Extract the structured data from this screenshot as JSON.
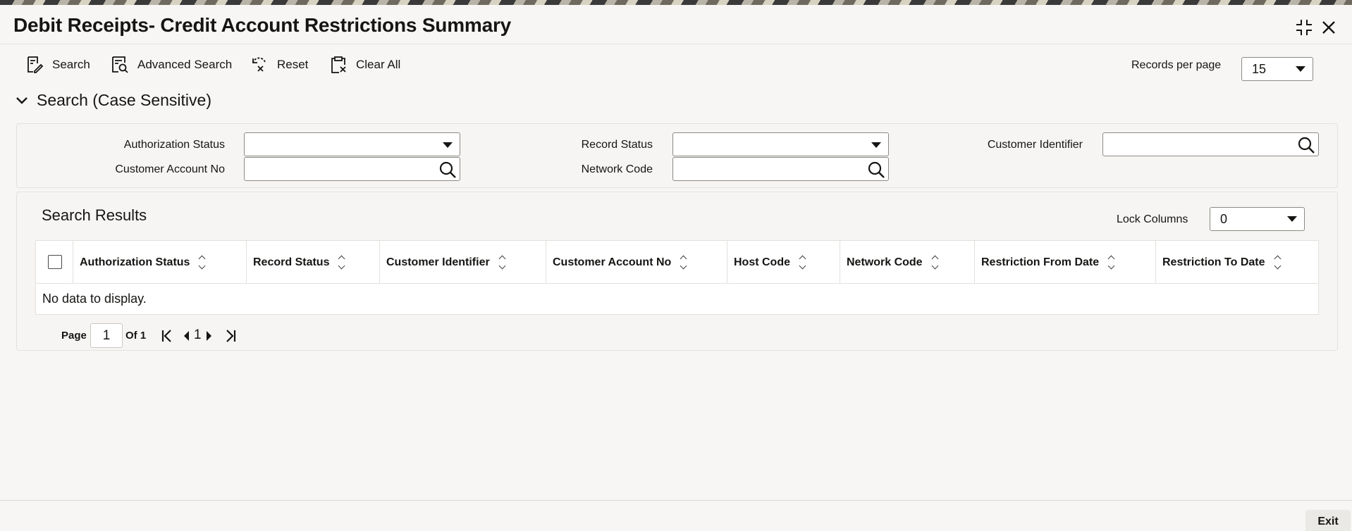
{
  "window": {
    "title": "Debit Receipts- Credit Account Restrictions Summary"
  },
  "toolbar": {
    "search_label": "Search",
    "advanced_search_label": "Advanced Search",
    "reset_label": "Reset",
    "clear_all_label": "Clear All",
    "records_per_page_label": "Records per page",
    "records_per_page_value": "15"
  },
  "search_section": {
    "title": "Search (Case Sensitive)",
    "fields": {
      "authorization_status": {
        "label": "Authorization Status",
        "value": ""
      },
      "record_status": {
        "label": "Record Status",
        "value": ""
      },
      "customer_identifier": {
        "label": "Customer Identifier",
        "value": ""
      },
      "customer_account_no": {
        "label": "Customer Account No",
        "value": ""
      },
      "network_code": {
        "label": "Network Code",
        "value": ""
      }
    }
  },
  "results": {
    "title": "Search Results",
    "lock_columns_label": "Lock Columns",
    "lock_columns_value": "0",
    "columns": [
      "Authorization Status",
      "Record Status",
      "Customer Identifier",
      "Customer Account No",
      "Host Code",
      "Network Code",
      "Restriction From Date",
      "Restriction To Date"
    ],
    "empty_message": "No data to display."
  },
  "pagination": {
    "page_label": "Page",
    "current_page": "1",
    "of_label": "Of 1",
    "page_link": "1"
  },
  "footer": {
    "exit_label": "Exit"
  }
}
